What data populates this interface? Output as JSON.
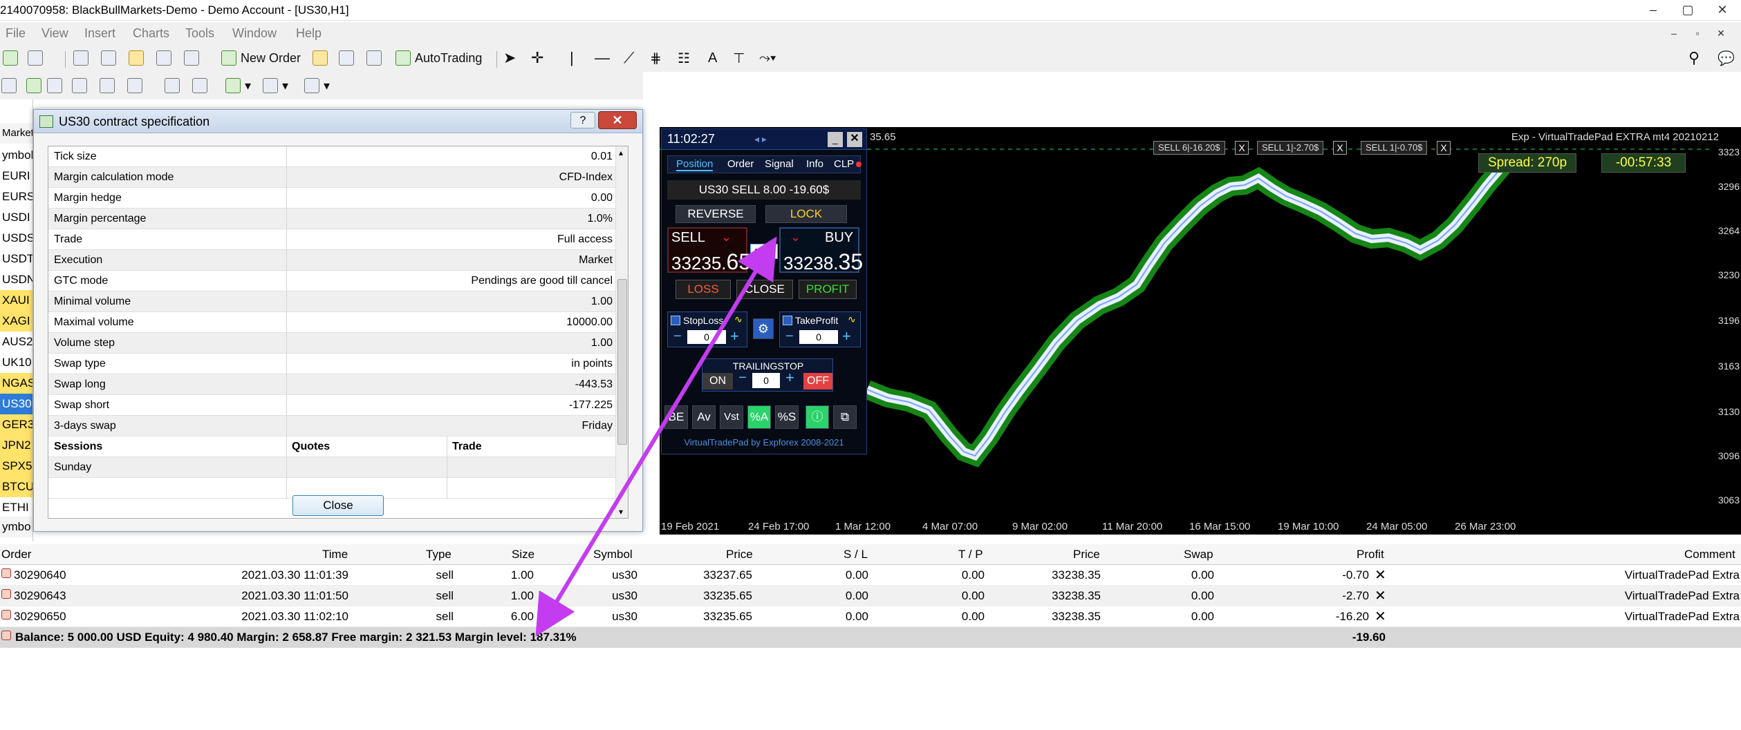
{
  "window": {
    "title": "2140070958: BlackBullMarkets-Demo - Demo Account - [US30,H1]"
  },
  "menu": [
    "File",
    "View",
    "Insert",
    "Charts",
    "Tools",
    "Window",
    "Help"
  ],
  "toolbar": {
    "new_order": "New Order",
    "autotrading": "AutoTrading"
  },
  "market_watch": {
    "header": "Market W",
    "col": "ymbol",
    "symbols": [
      "EURI",
      "EURS",
      "USDI",
      "USDS",
      "USDT",
      "USDN",
      "XAUI",
      "XAGI",
      "AUS2",
      "UK10",
      "NGAS",
      "US30",
      "GER3",
      "JPN2",
      "SPX5",
      "BTCU",
      "ETHI"
    ],
    "footer": "ymbo"
  },
  "dialog": {
    "title": "US30 contract specification",
    "help": "?",
    "rows": [
      {
        "k": "Tick size",
        "v": "0.01"
      },
      {
        "k": "Margin calculation mode",
        "v": "CFD-Index"
      },
      {
        "k": "Margin hedge",
        "v": "0.00"
      },
      {
        "k": "Margin percentage",
        "v": "1.0%"
      },
      {
        "k": "Trade",
        "v": "Full access"
      },
      {
        "k": "Execution",
        "v": "Market"
      },
      {
        "k": "GTC mode",
        "v": "Pendings are good till cancel"
      },
      {
        "k": "Minimal volume",
        "v": "1.00"
      },
      {
        "k": "Maximal volume",
        "v": "10000.00"
      },
      {
        "k": "Volume step",
        "v": "1.00"
      },
      {
        "k": "Swap type",
        "v": "in points"
      },
      {
        "k": "Swap long",
        "v": "-443.53"
      },
      {
        "k": "Swap short",
        "v": "-177.225"
      },
      {
        "k": "3-days swap",
        "v": "Friday"
      }
    ],
    "sessions_header": {
      "a": "Sessions",
      "b": "Quotes",
      "c": "Trade"
    },
    "sunday": "Sunday",
    "close_label": "Close"
  },
  "chart": {
    "expert": "Exp - VirtualTradePad EXTRA mt4 20210212",
    "price_top": "35.65",
    "spread": "Spread: 270p",
    "timer": "-00:57:33",
    "positions": [
      "SELL 6|-16.20$",
      "SELL 1|-2.70$",
      "SELL 1|-0.70$"
    ],
    "close_x": "X",
    "x_ticks": [
      "19 Feb 2021",
      "24 Feb 17:00",
      "1 Mar 12:00",
      "4 Mar 07:00",
      "9 Mar 02:00",
      "11 Mar 20:00",
      "16 Mar 15:00",
      "19 Mar 10:00",
      "24 Mar 05:00",
      "26 Mar 23:00"
    ],
    "y_ticks": [
      "3323",
      "3296",
      "3264",
      "3230",
      "3196",
      "3163",
      "3130",
      "3096",
      "3063"
    ]
  },
  "vtp": {
    "time": "11:02:27",
    "arrows": "◂ ▸",
    "tabs": [
      "Position",
      "Order",
      "Signal",
      "Info",
      "CLP"
    ],
    "info": "US30 SELL 8.00 -19.60$",
    "reverse": "REVERSE",
    "lock": "LOCK",
    "sell_label": "SELL",
    "buy_label": "BUY",
    "sell_price_a": "33235.",
    "sell_price_b": "65",
    "buy_price_a": "33238.",
    "buy_price_b": "35",
    "spread_badge": "48.54",
    "loss": "LOSS",
    "close": "CLOSE",
    "profit": "PROFIT",
    "stoploss": "StopLoss",
    "takeprofit": "TakeProfit",
    "sl_value": "0",
    "tp_value": "0",
    "trailing": "TRAILINGSTOP",
    "on": "ON",
    "off": "OFF",
    "trail_value": "0",
    "bottom_icons": [
      "BE",
      "Av",
      "Vst",
      "%A",
      "%S"
    ],
    "footer": "VirtualTradePad by Expforex 2008-2021"
  },
  "terminal": {
    "headers": [
      "Order",
      "Time",
      "Type",
      "Size",
      "Symbol",
      "Price",
      "S / L",
      "T / P",
      "Price",
      "Swap",
      "Profit",
      "Comment"
    ],
    "rows": [
      [
        "30290640",
        "2021.03.30 11:01:39",
        "sell",
        "1.00",
        "us30",
        "33237.65",
        "0.00",
        "0.00",
        "33238.35",
        "0.00",
        "-0.70",
        "VirtualTradePad Extra"
      ],
      [
        "30290643",
        "2021.03.30 11:01:50",
        "sell",
        "1.00",
        "us30",
        "33235.65",
        "0.00",
        "0.00",
        "33238.35",
        "0.00",
        "-2.70",
        "VirtualTradePad Extra"
      ],
      [
        "30290650",
        "2021.03.30 11:02:10",
        "sell",
        "6.00",
        "us30",
        "33235.65",
        "0.00",
        "0.00",
        "33238.35",
        "0.00",
        "-16.20",
        "VirtualTradePad Extra"
      ]
    ],
    "balance": "Balance: 5 000.00 USD  Equity: 4 980.40  Margin: 2 658.87  Free margin: 2 321.53  Margin level: 187.31%",
    "total": "-19.60"
  },
  "colors": {
    "arrow": "#c33cf0",
    "accent": "#2f7bd8",
    "candle": "#1a9d1a"
  }
}
